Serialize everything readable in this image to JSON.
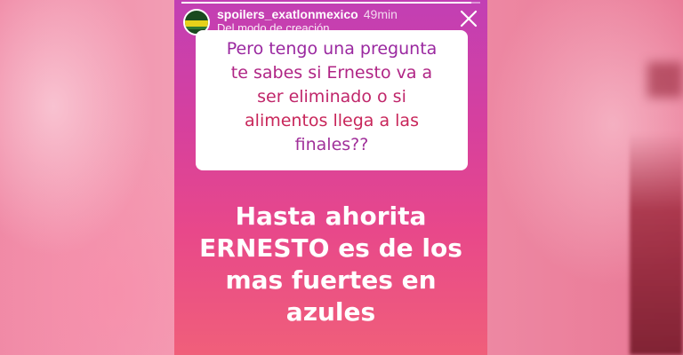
{
  "story": {
    "username": "spoilers_exatlonmexico",
    "time_ago": "49min",
    "subtitle": "Del modo de creación",
    "progress": 0.97,
    "avatar_icon": "exatlon-logo-avatar",
    "close_icon": "close-icon"
  },
  "question": {
    "lines": [
      "Pero tengo una pregunta",
      "te sabes si Ernesto va a",
      "ser eliminado o si",
      "alimentos llega a las",
      "finales??"
    ]
  },
  "answer": {
    "lines": [
      "Hasta ahorita",
      "ERNESTO es de los",
      "mas fuertes en",
      "azules"
    ]
  },
  "colors": {
    "story_gradient_top": "#c23fb4",
    "story_gradient_bottom": "#f05f7a",
    "card_background": "#ffffff",
    "question_text": "#b02585"
  }
}
